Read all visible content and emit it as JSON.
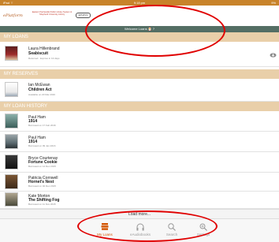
{
  "status_bar": {
    "left": "iPad ⌔",
    "time": "9:18 pm",
    "right": "9%"
  },
  "header": {
    "brand": "ePlatform",
    "tagline": "Eastern Panhandle Public Library System & Shepherd University Library",
    "partner_logo": "EPHPLS"
  },
  "welcome_bar": {
    "text": "Welcome Loans  🎅 ?"
  },
  "sections": {
    "my_loans": "MY LOANS",
    "my_reserves": "MY RESERVES",
    "my_loan_history": "MY LOAN HISTORY"
  },
  "loans": [
    {
      "author": "Laura Hillenbrand",
      "title": "Seabiscuit",
      "meta": "Returned · Expires in 13 days"
    }
  ],
  "reserves": [
    {
      "author": "Ian McEwan",
      "title": "Children Act",
      "meta": "Available on 20 Mar 2016"
    }
  ],
  "history": [
    {
      "author": "Paul Ham",
      "title": "1914",
      "meta": "Borrowed on 17 Feb 2016"
    },
    {
      "author": "Paul Ham",
      "title": "1914",
      "meta": "Borrowed on 09 Jan 2016"
    },
    {
      "author": "Bryce Courtenay",
      "title": "Fortune Cookie",
      "meta": "Borrowed on 14 Dec 2015"
    },
    {
      "author": "Patricia Cornwell",
      "title": "Hornet's Nest",
      "meta": "Borrowed on 02 Dec 2015"
    },
    {
      "author": "Kate Morton",
      "title": "The Shifting Fog",
      "meta": "Borrowed on 11 Nov 2015"
    }
  ],
  "load_more": "Load more...",
  "tabs": [
    {
      "label": "My Loans",
      "icon": "books-icon",
      "active": true
    },
    {
      "label": "eAudiobooks",
      "icon": "headphones-icon",
      "active": false
    },
    {
      "label": "Search",
      "icon": "search-icon",
      "active": false
    },
    {
      "label": "Settings",
      "icon": "settings-icon",
      "active": false
    }
  ],
  "colors": {
    "status_bar": "#c8832a",
    "section_header": "#e9cfa9",
    "welcome_bar": "#546e64",
    "active_tab": "#d35400",
    "annotation": "#e00000"
  }
}
